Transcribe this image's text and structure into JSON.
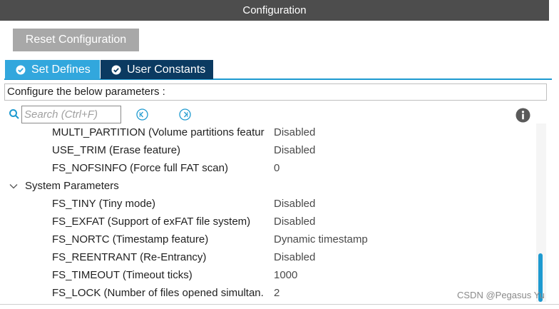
{
  "window": {
    "title": "Configuration"
  },
  "toolbar": {
    "reset_label": "Reset Configuration"
  },
  "tabs": [
    {
      "label": "Set Defines",
      "icon": "check-circle-icon",
      "active": true
    },
    {
      "label": "User Constants",
      "icon": "check-circle-icon",
      "active": false
    }
  ],
  "info_text": "Configure the below parameters :",
  "search": {
    "placeholder": "Search (Ctrl+F)",
    "icon": "search-icon"
  },
  "parameters": [
    {
      "name": "MULTI_PARTITION (Volume partitions featur",
      "value": "Disabled"
    },
    {
      "name": "USE_TRIM (Erase feature)",
      "value": "Disabled"
    },
    {
      "name": "FS_NOFSINFO (Force full FAT scan)",
      "value": "0"
    }
  ],
  "group": {
    "label": "System Parameters",
    "expanded": true,
    "items": [
      {
        "name": "FS_TINY (Tiny mode)",
        "value": "Disabled"
      },
      {
        "name": "FS_EXFAT (Support of exFAT file system)",
        "value": "Disabled"
      },
      {
        "name": "FS_NORTC (Timestamp feature)",
        "value": "Dynamic timestamp"
      },
      {
        "name": "FS_REENTRANT (Re-Entrancy)",
        "value": "Disabled"
      },
      {
        "name": "FS_TIMEOUT (Timeout ticks)",
        "value": "1000"
      },
      {
        "name": "FS_LOCK (Number of files opened simultan.",
        "value": "2"
      }
    ]
  },
  "watermark": "CSDN @Pegasus Yu",
  "colors": {
    "title_bar": "#4d4d4d",
    "tab_active": "#32a7dd",
    "tab_inactive": "#0b3a61",
    "accent": "#1e9ad0",
    "button": "#a8a8a8"
  }
}
